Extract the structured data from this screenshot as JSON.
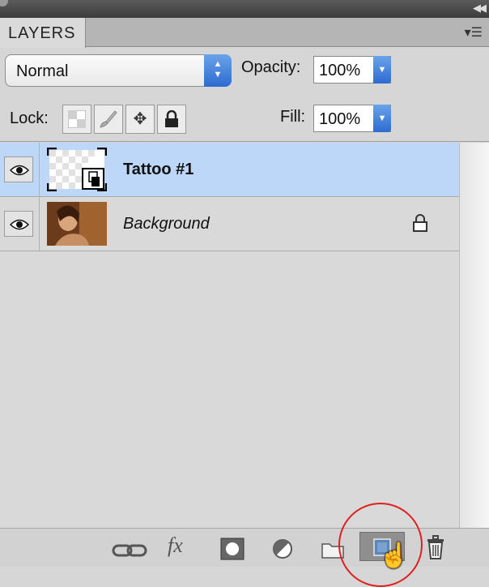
{
  "panel": {
    "tab_label": "LAYERS",
    "collapse_glyph": "◀◀",
    "menu_glyph": "▾☰"
  },
  "blend_mode": {
    "value": "Normal"
  },
  "opacity": {
    "label": "Opacity:",
    "value": "100%"
  },
  "lock": {
    "label": "Lock:"
  },
  "fill": {
    "label": "Fill:",
    "value": "100%"
  },
  "layers": [
    {
      "name": "Tattoo #1",
      "visible": true,
      "selected": true,
      "locked": false
    },
    {
      "name": "Background",
      "visible": true,
      "selected": false,
      "locked": true
    }
  ],
  "bottom_icons": [
    "link-icon",
    "fx-icon",
    "mask-icon",
    "adjustment-icon",
    "folder-icon",
    "new-layer-icon",
    "trash-icon"
  ],
  "fx_label": "fx",
  "colors": {
    "selected_row": "#bcd7f7",
    "accent": "#2d6bd0",
    "highlight_circle": "#e01f1f"
  }
}
